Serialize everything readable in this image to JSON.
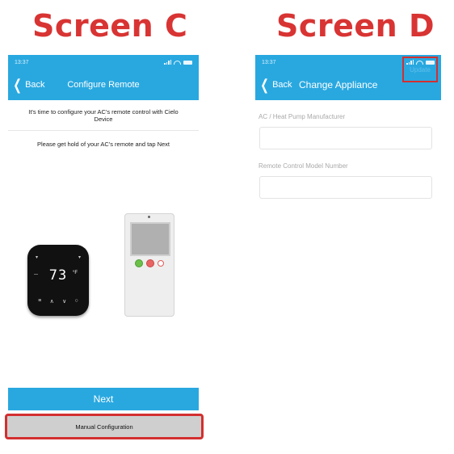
{
  "screen_c": {
    "heading": "Screen C",
    "status": {
      "time": "13:37"
    },
    "nav": {
      "back_label": "Back",
      "title": "Configure Remote"
    },
    "intro_text": "It's time to configure your AC's remote control with Cielo Device",
    "instruction_text": "Please get hold of your AC's remote and tap Next",
    "thermostat": {
      "temperature": "73",
      "unit": "°F"
    },
    "next_label": "Next",
    "manual_label": "Manual Configuration"
  },
  "screen_d": {
    "heading": "Screen D",
    "status": {
      "time": "13:37"
    },
    "nav": {
      "back_label": "Back",
      "title": "Change Appliance",
      "update_label": "Update"
    },
    "fields": [
      {
        "label": "AC / Heat Pump Manufacturer",
        "value": ""
      },
      {
        "label": "Remote Control Model Number",
        "value": ""
      }
    ]
  },
  "colors": {
    "accent": "#29a8e0",
    "highlight": "#d32f2f",
    "heading": "#d83433"
  }
}
